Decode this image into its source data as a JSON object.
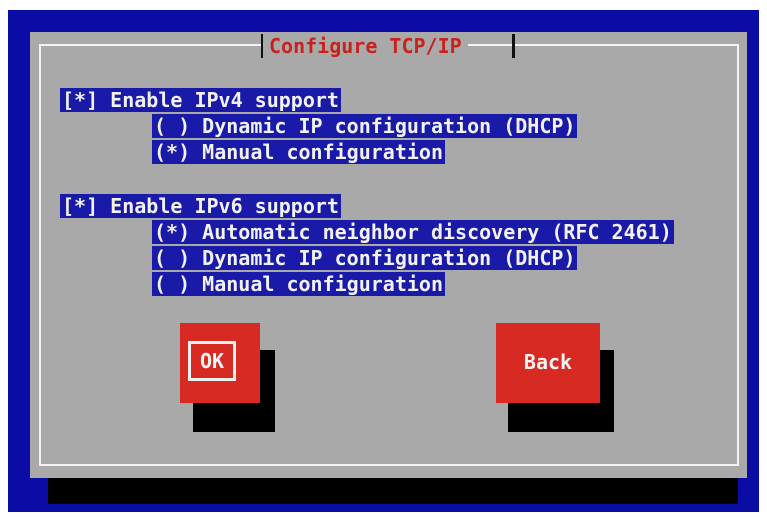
{
  "dialog": {
    "title": "Configure TCP/IP"
  },
  "ipv4": {
    "enable": "[*] Enable IPv4 support",
    "dhcp": "( ) Dynamic IP configuration (DHCP)",
    "manual": "(*) Manual configuration"
  },
  "ipv6": {
    "enable": "[*] Enable IPv6 support",
    "auto": "(*) Automatic neighbor discovery (RFC 2461)",
    "dhcp": "( ) Dynamic IP configuration (DHCP)",
    "manual": "( ) Manual configuration"
  },
  "buttons": {
    "ok": "OK",
    "back": "Back"
  },
  "colors": {
    "background": "#0b0ba6",
    "dialog": "#a9a9a9",
    "title": "#c9221e",
    "button": "#d62a23"
  }
}
